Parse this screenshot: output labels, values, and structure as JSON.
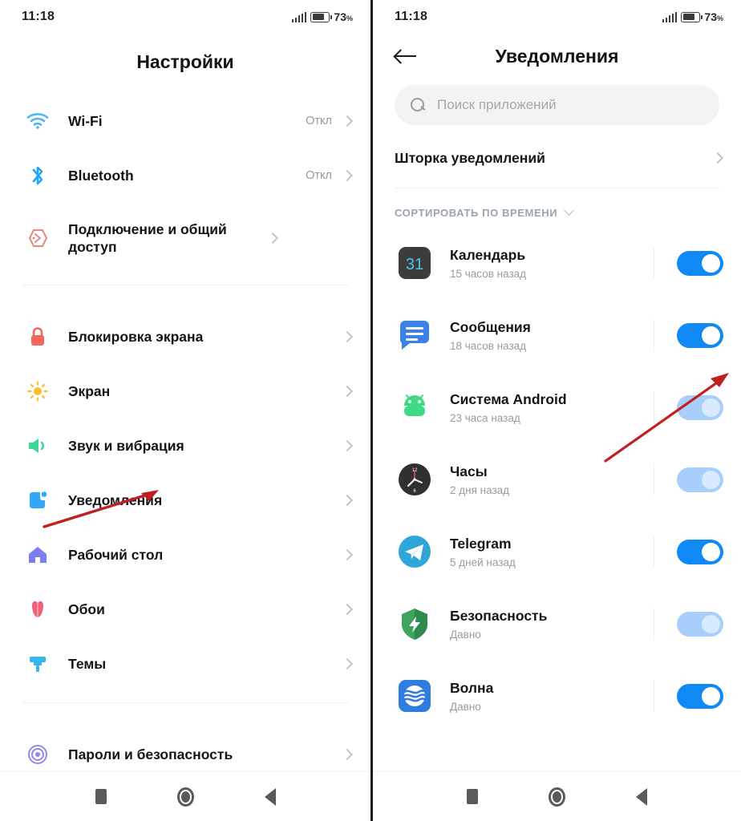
{
  "status_bar": {
    "time": "11:18",
    "battery_percent": "73",
    "percent_symbol": "%",
    "signal_icon": "signal-bars-icon",
    "battery_icon": "battery-icon"
  },
  "left_screen": {
    "title": "Настройки",
    "groups": [
      {
        "items": [
          {
            "label": "Wi-Fi",
            "value": "Откл",
            "icon": "wifi-icon"
          },
          {
            "label": "Bluetooth",
            "value": "Откл",
            "icon": "bluetooth-icon"
          },
          {
            "label": "Подключение и общий доступ",
            "value": "",
            "icon": "sharing-icon"
          }
        ]
      },
      {
        "items": [
          {
            "label": "Блокировка экрана",
            "value": "",
            "icon": "lock-icon"
          },
          {
            "label": "Экран",
            "value": "",
            "icon": "brightness-icon"
          },
          {
            "label": "Звук и вибрация",
            "value": "",
            "icon": "speaker-icon"
          },
          {
            "label": "Уведомления",
            "value": "",
            "icon": "notifications-icon"
          },
          {
            "label": "Рабочий стол",
            "value": "",
            "icon": "home-icon"
          },
          {
            "label": "Обои",
            "value": "",
            "icon": "wallpaper-flower-icon"
          },
          {
            "label": "Темы",
            "value": "",
            "icon": "themes-brush-icon"
          }
        ]
      },
      {
        "items": [
          {
            "label": "Пароли и безопасность",
            "value": "",
            "icon": "fingerprint-icon"
          }
        ]
      }
    ]
  },
  "right_screen": {
    "title": "Уведомления",
    "back_icon": "back-arrow-icon",
    "search": {
      "placeholder": "Поиск приложений",
      "icon": "search-icon"
    },
    "shade_row": {
      "label": "Шторка уведомлений"
    },
    "sort": {
      "label": "СОРТИРОВАТЬ ПО ВРЕМЕНИ",
      "icon": "chevron-down-icon"
    },
    "apps": [
      {
        "name": "Календарь",
        "time": "15 часов назад",
        "toggle": "on",
        "icon": "calendar-app-icon"
      },
      {
        "name": "Сообщения",
        "time": "18 часов назад",
        "toggle": "on",
        "icon": "messages-app-icon"
      },
      {
        "name": "Система Android",
        "time": "23 часа назад",
        "toggle": "off",
        "icon": "android-system-icon"
      },
      {
        "name": "Часы",
        "time": "2 дня назад",
        "toggle": "off",
        "icon": "clock-app-icon"
      },
      {
        "name": "Telegram",
        "time": "5 дней назад",
        "toggle": "on",
        "icon": "telegram-app-icon"
      },
      {
        "name": "Безопасность",
        "time": "Давно",
        "toggle": "off",
        "icon": "security-shield-icon"
      },
      {
        "name": "Волна",
        "time": "Давно",
        "toggle": "on",
        "icon": "volna-app-icon"
      }
    ]
  },
  "nav_bar": {
    "recents_icon": "recents-square-icon",
    "home_icon": "home-circle-icon",
    "back_icon": "back-triangle-icon"
  },
  "annotations": {
    "color": "#c0211f",
    "arrow_left_target": "Уведомления",
    "arrow_right_target": "Сообщения toggle"
  },
  "colors": {
    "toggle_on": "#1189f5",
    "toggle_off": "#a8cffb",
    "accent_blue": "#1189f5",
    "annotation_red": "#c0211f"
  }
}
